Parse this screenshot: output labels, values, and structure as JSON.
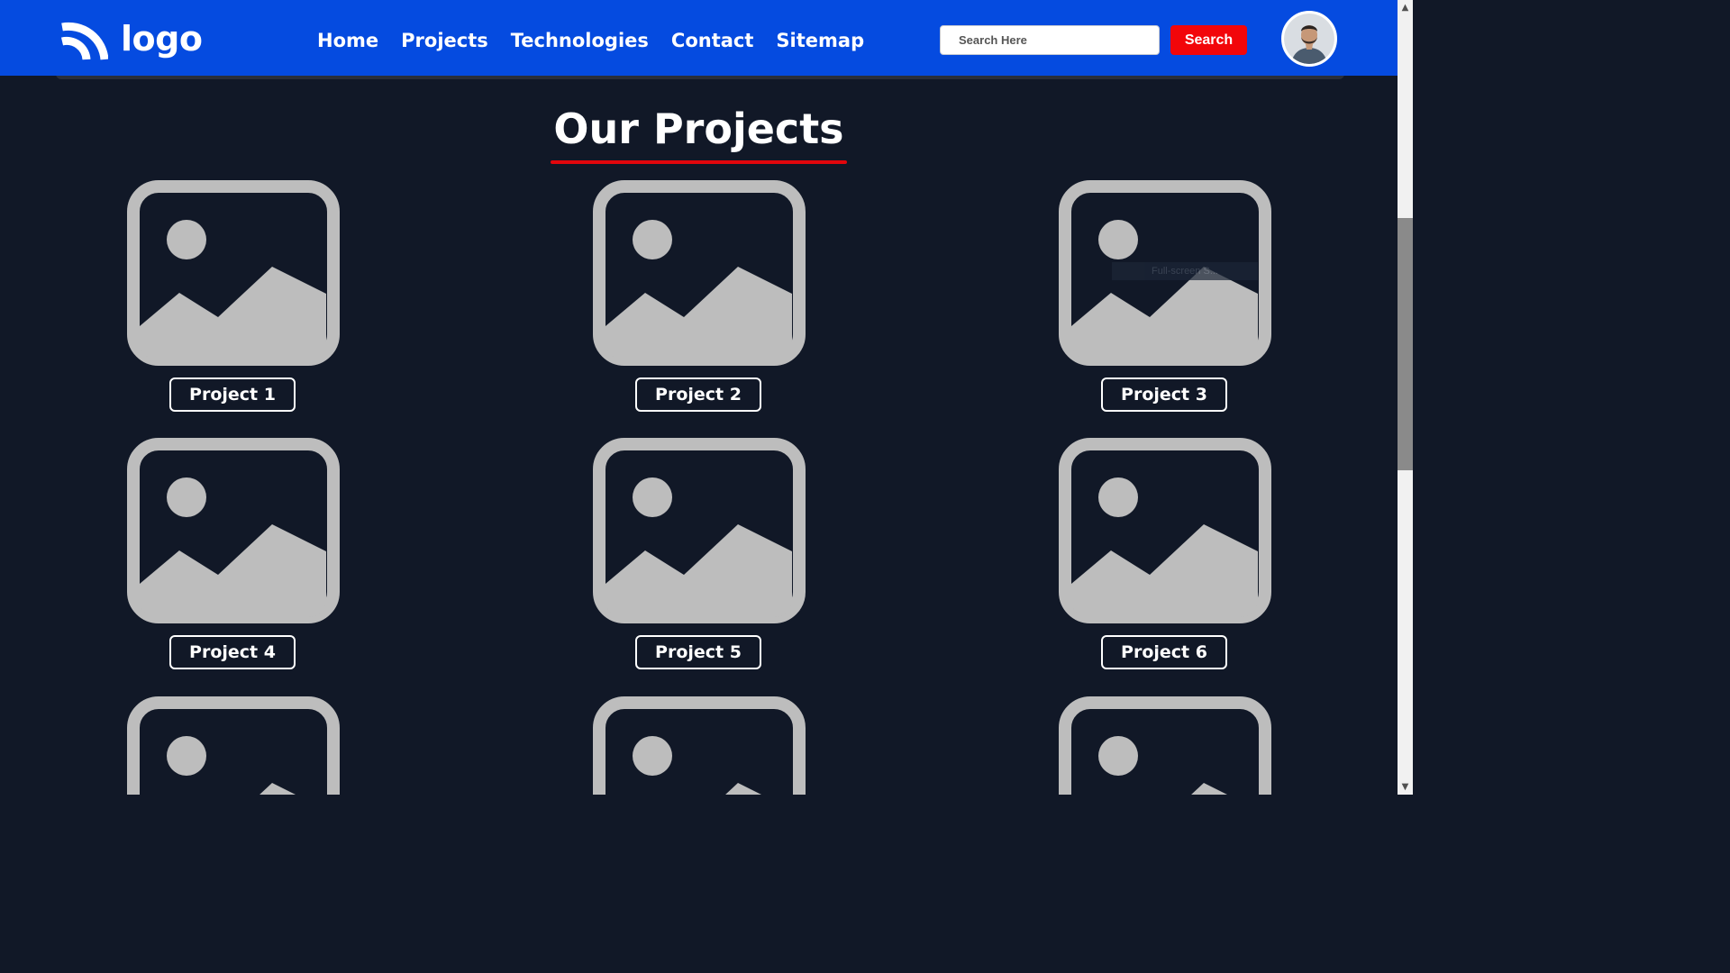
{
  "header": {
    "logo_text": "logo",
    "nav": [
      {
        "label": "Home"
      },
      {
        "label": "Projects"
      },
      {
        "label": "Technologies"
      },
      {
        "label": "Contact"
      },
      {
        "label": "Sitemap"
      }
    ],
    "search": {
      "placeholder": "Search Here",
      "button_label": "Search"
    },
    "avatar_icon": "user-avatar"
  },
  "main": {
    "title": "Our Projects",
    "projects": [
      {
        "label": "Project 1",
        "icon": "image-placeholder-icon"
      },
      {
        "label": "Project 2",
        "icon": "image-placeholder-icon"
      },
      {
        "label": "Project 3",
        "icon": "image-placeholder-icon"
      },
      {
        "label": "Project 4",
        "icon": "image-placeholder-icon"
      },
      {
        "label": "Project 5",
        "icon": "image-placeholder-icon"
      },
      {
        "label": "Project 6",
        "icon": "image-placeholder-icon"
      }
    ],
    "partial_row_count": 3
  },
  "tooltip": {
    "text": "Full-screen S..."
  },
  "colors": {
    "header_bg": "#054be0",
    "page_bg": "#111827",
    "accent_red": "#f2060a",
    "placeholder_gray": "#bdbdbd"
  }
}
